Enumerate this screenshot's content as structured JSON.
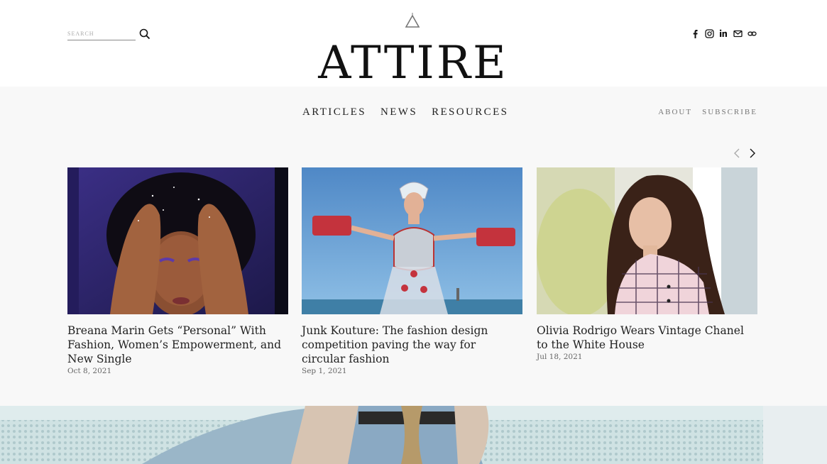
{
  "header": {
    "logo_text": "ATTIRE",
    "search": {
      "placeholder": "SEARCH"
    },
    "social_icons": [
      "facebook-icon",
      "instagram-icon",
      "linkedin-icon",
      "mail-icon",
      "link-icon"
    ]
  },
  "nav": {
    "primary": [
      "ARTICLES",
      "NEWS",
      "RESOURCES"
    ],
    "secondary": [
      "ABOUT",
      "SUBSCRIBE"
    ]
  },
  "carousel": {
    "articles": [
      {
        "title": "Breana Marin Gets “Personal” With Fashion, Women’s Empowerment, and New Single",
        "date": "Oct 8, 2021"
      },
      {
        "title": "Junk Kouture: The fashion design competition paving the way for circular fashion",
        "date": "Sep 1, 2021"
      },
      {
        "title": "Olivia Rodrigo Wears Vintage Chanel to the White House",
        "date": "Jul 18, 2021"
      }
    ]
  },
  "colors": {
    "background": "#ffffff",
    "band": "#f8f8f8",
    "text": "#222222",
    "muted": "#777777"
  }
}
